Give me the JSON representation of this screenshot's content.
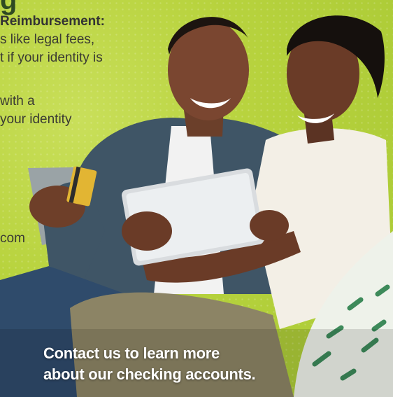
{
  "ad": {
    "heading_fragment": "g",
    "reimbursement_title": "Reimbursement:",
    "body_lines": [
      "s like legal fees,",
      "t if your identity is",
      "with a",
      "your identity",
      "com"
    ],
    "cta_lines": [
      "Contact us to learn more",
      "about our checking accounts."
    ],
    "colors": {
      "background": "#b8d33e",
      "cta_text": "#ffffff",
      "body_text": "#3a3a33"
    }
  }
}
